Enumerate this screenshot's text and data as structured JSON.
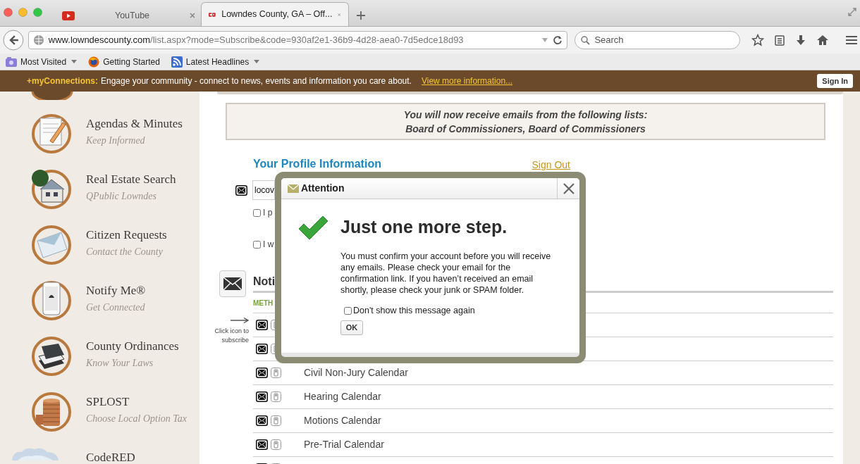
{
  "browser": {
    "tabs": [
      {
        "title": "YouTube",
        "selected": false
      },
      {
        "title": "Lowndes County, GA – Off...",
        "selected": true
      }
    ],
    "url_host": "www.lowndescounty.com",
    "url_path": "/list.aspx?mode=Subscribe&code=930af2e1-36b9-4d28-aea0-7d5edce18d93",
    "search": {
      "placeholder": "Search"
    },
    "bookmarks": [
      {
        "label": "Most Visited",
        "dropdown": true
      },
      {
        "label": "Getting Started",
        "dropdown": false
      },
      {
        "label": "Latest Headlines",
        "dropdown": true
      }
    ]
  },
  "connections_bar": {
    "brand": "+myConnections:",
    "text": "Engage your community - connect to news, events and information you care about.",
    "link": "View more information...",
    "button": "Sign In"
  },
  "sidebar": {
    "items": [
      {
        "title": "Agendas & Minutes",
        "subtitle": "Keep Informed"
      },
      {
        "title": "Real Estate Search",
        "subtitle": "QPublic Lowndes"
      },
      {
        "title": "Citizen Requests",
        "subtitle": "Contact the County"
      },
      {
        "title": "Notify Me®",
        "subtitle": "Get Connected"
      },
      {
        "title": "County Ordinances",
        "subtitle": "Know Your Laws"
      },
      {
        "title": "SPLOST",
        "subtitle": "Choose Local Option Tax"
      },
      {
        "title": "CodeRED"
      }
    ]
  },
  "notice": {
    "lines": [
      "You will now receive emails from the following lists:",
      "Board of Commissioners, Board of Commissioners"
    ]
  },
  "profile": {
    "heading": "Your Profile Information",
    "sign_out": "Sign Out",
    "email_value": "locov",
    "options": [
      {
        "label": "I p",
        "checked": false
      },
      {
        "label": "I w",
        "checked": false
      }
    ]
  },
  "notifications": {
    "heading": "Noti",
    "column": "METH",
    "hint": "Click icon to subscribe",
    "rows": [
      {},
      {},
      {
        "title": "Civil Non-Jury Calendar"
      },
      {
        "title": "Hearing Calendar"
      },
      {
        "title": "Motions Calendar"
      },
      {
        "title": "Pre-Trial Calendar"
      },
      {}
    ]
  },
  "dialog": {
    "title": "Attention",
    "heading": "Just one more step.",
    "message": "You must confirm your account before you will receive any emails. Please check your email for the confirmation link. If you haven’t received an email shortly, please check your junk or SPAM folder.",
    "dont_show": {
      "label": "Don't show this message again",
      "checked": false
    },
    "ok": "OK"
  }
}
